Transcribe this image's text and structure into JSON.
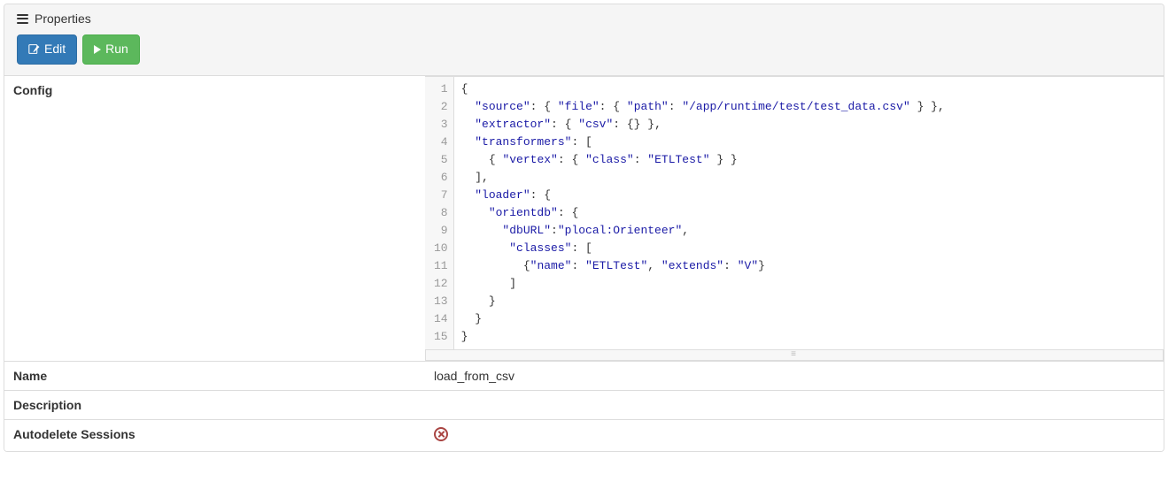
{
  "panel": {
    "title": "Properties"
  },
  "toolbar": {
    "edit_label": "Edit",
    "run_label": "Run"
  },
  "fields": {
    "config_label": "Config",
    "name_label": "Name",
    "name_value": "load_from_csv",
    "description_label": "Description",
    "description_value": "",
    "autodelete_label": "Autodelete Sessions",
    "autodelete_value": false
  },
  "code": {
    "lines": [
      [
        [
          "p",
          "{"
        ]
      ],
      [
        [
          "w",
          "  "
        ],
        [
          "k",
          "\"source\""
        ],
        [
          "p",
          ": { "
        ],
        [
          "k",
          "\"file\""
        ],
        [
          "p",
          ": { "
        ],
        [
          "k",
          "\"path\""
        ],
        [
          "p",
          ": "
        ],
        [
          "s",
          "\"/app/runtime/test/test_data.csv\""
        ],
        [
          "p",
          " } },"
        ]
      ],
      [
        [
          "w",
          "  "
        ],
        [
          "k",
          "\"extractor\""
        ],
        [
          "p",
          ": { "
        ],
        [
          "k",
          "\"csv\""
        ],
        [
          "p",
          ": {} },"
        ]
      ],
      [
        [
          "w",
          "  "
        ],
        [
          "k",
          "\"transformers\""
        ],
        [
          "p",
          ": ["
        ]
      ],
      [
        [
          "w",
          "    "
        ],
        [
          "p",
          "{ "
        ],
        [
          "k",
          "\"vertex\""
        ],
        [
          "p",
          ": { "
        ],
        [
          "k",
          "\"class\""
        ],
        [
          "p",
          ": "
        ],
        [
          "s",
          "\"ETLTest\""
        ],
        [
          "p",
          " } }"
        ]
      ],
      [
        [
          "w",
          "  "
        ],
        [
          "p",
          "],"
        ]
      ],
      [
        [
          "w",
          "  "
        ],
        [
          "k",
          "\"loader\""
        ],
        [
          "p",
          ": {"
        ]
      ],
      [
        [
          "w",
          "    "
        ],
        [
          "k",
          "\"orientdb\""
        ],
        [
          "p",
          ": {"
        ]
      ],
      [
        [
          "w",
          "      "
        ],
        [
          "k",
          "\"dbURL\""
        ],
        [
          "p",
          ":"
        ],
        [
          "s",
          "\"plocal:Orienteer\""
        ],
        [
          "p",
          ","
        ]
      ],
      [
        [
          "w",
          "       "
        ],
        [
          "k",
          "\"classes\""
        ],
        [
          "p",
          ": ["
        ]
      ],
      [
        [
          "w",
          "         "
        ],
        [
          "p",
          "{"
        ],
        [
          "k",
          "\"name\""
        ],
        [
          "p",
          ": "
        ],
        [
          "s",
          "\"ETLTest\""
        ],
        [
          "p",
          ", "
        ],
        [
          "k",
          "\"extends\""
        ],
        [
          "p",
          ": "
        ],
        [
          "s",
          "\"V\""
        ],
        [
          "p",
          "}"
        ]
      ],
      [
        [
          "w",
          "       "
        ],
        [
          "p",
          "]"
        ]
      ],
      [
        [
          "w",
          "    "
        ],
        [
          "p",
          "}"
        ]
      ],
      [
        [
          "w",
          "  "
        ],
        [
          "p",
          "}"
        ]
      ],
      [
        [
          "p",
          "}"
        ]
      ]
    ]
  }
}
